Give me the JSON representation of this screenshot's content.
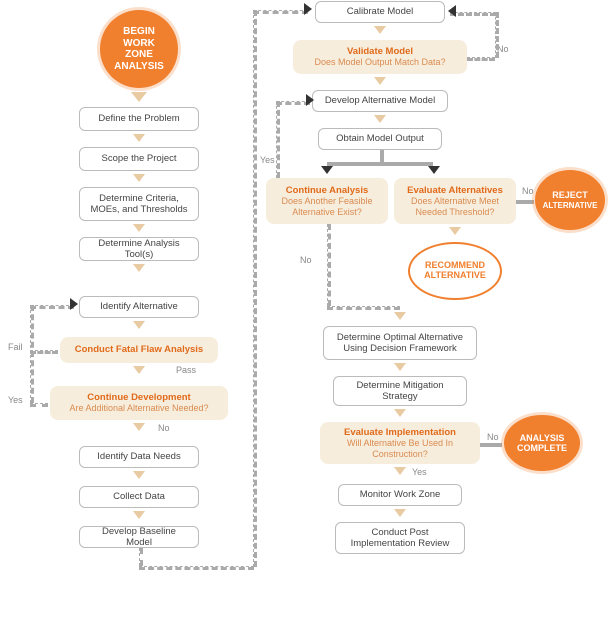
{
  "start": {
    "line1": "BEGIN",
    "line2": "WORK ZONE",
    "line3": "ANALYSIS"
  },
  "define_problem": "Define the Problem",
  "scope_project": "Scope the Project",
  "determine_criteria": "Determine Criteria, MOEs, and Thresholds",
  "determine_tools": "Determine Analysis Tool(s)",
  "identify_alternative": "Identify Alternative",
  "conduct_fatal_flaw": {
    "title": "Conduct Fatal Flaw Analysis"
  },
  "continue_development": {
    "title": "Continue Development",
    "question": "Are Additional Alternative Needed?"
  },
  "identify_data_needs": "Identify Data Needs",
  "collect_data": "Collect Data",
  "develop_baseline": "Develop Baseline Model",
  "calibrate_model": "Calibrate Model",
  "validate_model": {
    "title": "Validate Model",
    "question": "Does Model Output Match Data?"
  },
  "develop_alt_model": "Develop Alternative Model",
  "obtain_model_output": "Obtain Model Output",
  "continue_analysis": {
    "title": "Continue Analysis",
    "question": "Does Another Feasible Alternative Exist?"
  },
  "evaluate_alternatives": {
    "title": "Evaluate Alternatives",
    "question": "Does Alternative Meet Needed Threshold?"
  },
  "reject_alternative": {
    "line1": "REJECT",
    "line2": "ALTERNATIVE"
  },
  "recommend_alternative": {
    "line1": "RECOMMEND",
    "line2": "ALTERNATIVE"
  },
  "determine_optimal": "Determine Optimal Alternative Using Decision Framework",
  "determine_mitigation": "Determine Mitigation Strategy",
  "evaluate_implementation": {
    "title": "Evaluate Implementation",
    "question": "Will Alternative Be Used In Construction?"
  },
  "analysis_complete": {
    "line1": "ANALYSIS",
    "line2": "COMPLETE"
  },
  "monitor_work_zone": "Monitor Work Zone",
  "conduct_post_review": "Conduct Post Implementation Review",
  "labels": {
    "no": "No",
    "yes": "Yes",
    "fail": "Fail",
    "pass": "Pass"
  }
}
